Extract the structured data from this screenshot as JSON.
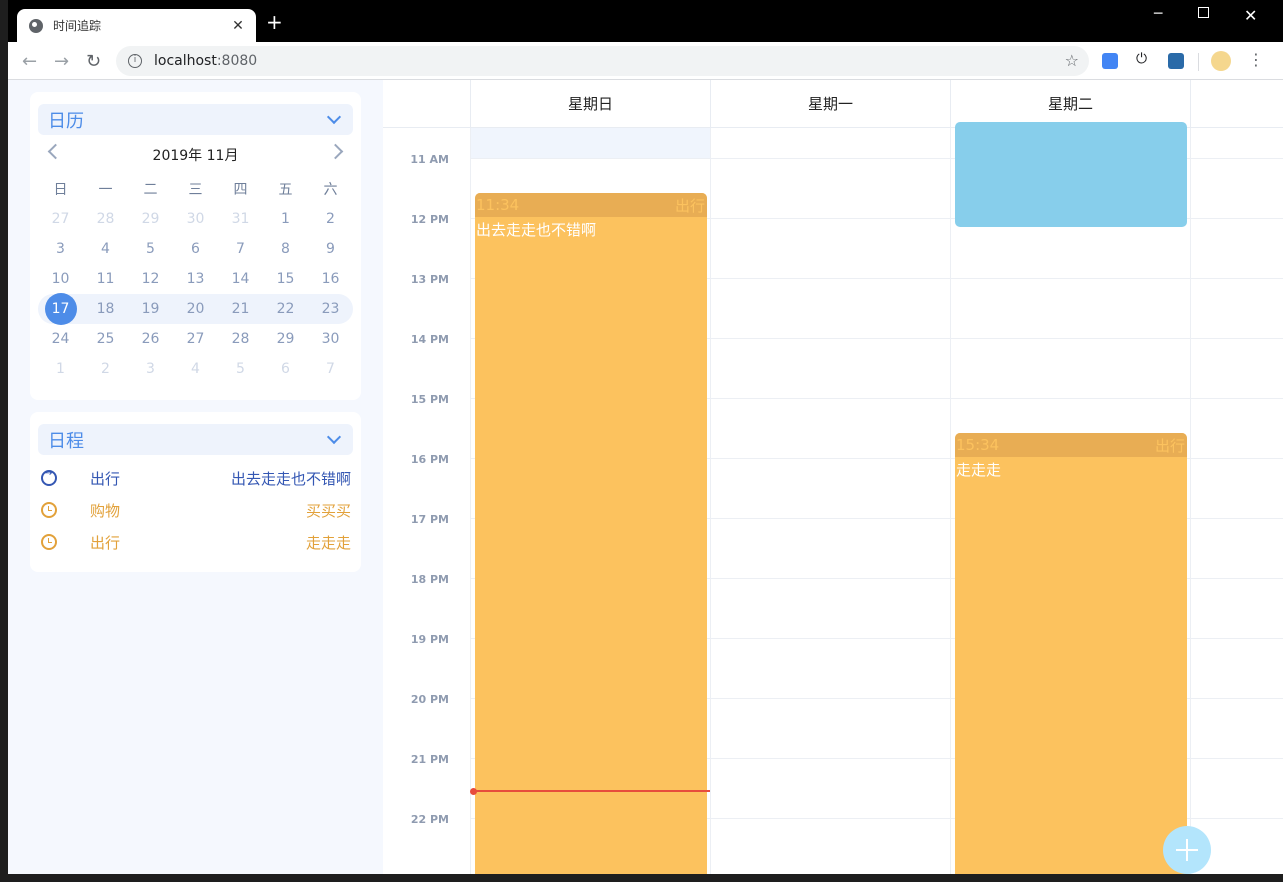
{
  "browser": {
    "tab_title": "时间追踪",
    "tab_close": "✕",
    "new_tab": "+",
    "url_host": "localhost",
    "url_port": ":8080",
    "min": "─",
    "close": "✕",
    "back": "←",
    "forward": "→",
    "reload": "↻",
    "star": "☆",
    "menu": "⋮",
    "power": "⏻",
    "info": "i"
  },
  "calendar_card": {
    "title": "日历",
    "month_label": "2019年  11月",
    "weekdays": [
      "日",
      "一",
      "二",
      "三",
      "四",
      "五",
      "六"
    ],
    "weeks": [
      [
        "27",
        "28",
        "29",
        "30",
        "31",
        "1",
        "2"
      ],
      [
        "3",
        "4",
        "5",
        "6",
        "7",
        "8",
        "9"
      ],
      [
        "10",
        "11",
        "12",
        "13",
        "14",
        "15",
        "16"
      ],
      [
        "17",
        "18",
        "19",
        "20",
        "21",
        "22",
        "23"
      ],
      [
        "24",
        "25",
        "26",
        "27",
        "28",
        "29",
        "30"
      ],
      [
        "1",
        "2",
        "3",
        "4",
        "5",
        "6",
        "7"
      ]
    ],
    "selected_day": "17"
  },
  "schedule_card": {
    "title": "日程",
    "items": [
      {
        "category": "出行",
        "description": "出去走走也不错啊",
        "icon": "arrow-circle-icon",
        "color": "#3457b3"
      },
      {
        "category": "购物",
        "description": "买买买",
        "icon": "clock-icon",
        "color": "#e2a13a"
      },
      {
        "category": "出行",
        "description": "走走走",
        "icon": "clock-icon",
        "color": "#e2a13a"
      }
    ]
  },
  "week_view": {
    "days": [
      "星期日",
      "星期一",
      "星期二"
    ],
    "hours": [
      "11 AM",
      "12 PM",
      "13 PM",
      "14 PM",
      "15 PM",
      "16 PM",
      "17 PM",
      "18 PM",
      "19 PM",
      "20 PM",
      "21 PM",
      "22 PM"
    ],
    "events": [
      {
        "time": "11:34",
        "category": "出行",
        "text": "出去走走也不错啊",
        "color": "#fcc25e"
      },
      {
        "time": "15:34",
        "category": "出行",
        "text": "走走走",
        "color": "#fcc25e"
      }
    ],
    "blue_event_color": "#87ceeb",
    "now_line_color": "#e74c3c"
  },
  "fab": {
    "icon": "plus-icon",
    "color": "#b3e5fc"
  }
}
